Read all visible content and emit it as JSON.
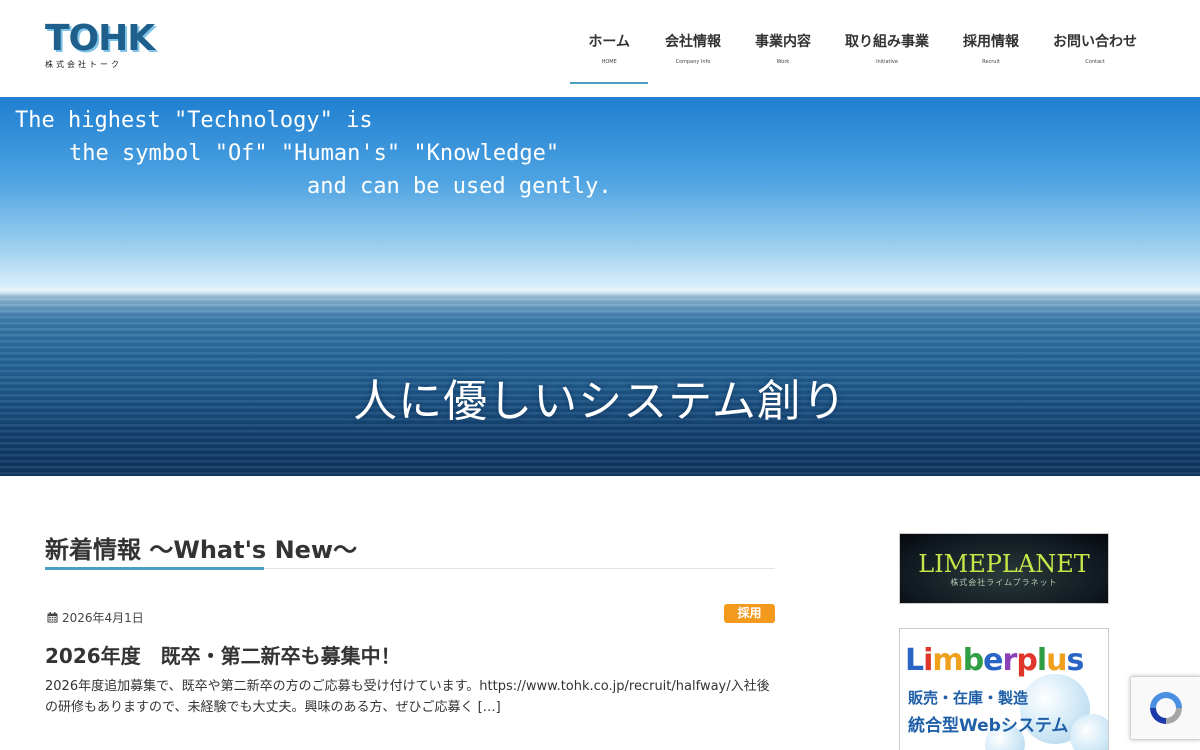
{
  "header": {
    "logo": {
      "main": "TOHK",
      "sub": "株式会社トーク"
    },
    "nav": [
      {
        "label": "ホーム",
        "sub": "HOME"
      },
      {
        "label": "会社情報",
        "sub": "Company Info"
      },
      {
        "label": "事業内容",
        "sub": "Work"
      },
      {
        "label": "取り組み事業",
        "sub": "Initiative"
      },
      {
        "label": "採用情報",
        "sub": "Recruit"
      },
      {
        "label": "お問い合わせ",
        "sub": "Contact"
      }
    ]
  },
  "hero": {
    "line1": "The highest \"Technology\" is",
    "line2": "the symbol \"Of\" \"Human's\" \"Knowledge\"",
    "line3": "and can be used gently.",
    "catchphrase": "人に優しいシステム創り"
  },
  "news": {
    "heading": "新着情報 ～What's New～",
    "posts": [
      {
        "date": "2026年4月1日",
        "category": "採用",
        "title": "2026年度　既卒・第二新卒も募集中！",
        "excerpt": "2026年度追加募集で、既卒や第二新卒の方のご応募も受け付けています。https://www.tohk.co.jp/recruit/halfway/入社後の研修もありますので、未経験でも大丈夫。興味のある方、ぜひご応募く […]"
      }
    ]
  },
  "sidebar": {
    "banner1": {
      "title": "LIMEPLANET",
      "sub": "株式会社ライムプラネット"
    },
    "banner2": {
      "brand_parts": [
        "L",
        "i",
        "m",
        "b",
        "e",
        "r",
        "p",
        "l",
        "u",
        "s"
      ],
      "brand_colors": [
        "#2a64c5",
        "#e0352b",
        "#f0a11c",
        "#2f9e44",
        "#2a64c5",
        "#8c3fb6",
        "#e0352b",
        "#2f9e44",
        "#f0a11c",
        "#2a64c5"
      ],
      "line1": "販売・在庫・製造",
      "line2": "統合型Webシステム"
    }
  },
  "colors": {
    "accent": "#4a9ec4",
    "badge": "#f39a1e",
    "logo": "#1f5f8b"
  },
  "icons": {
    "date": "calendar-icon",
    "captcha": "recaptcha-icon"
  }
}
